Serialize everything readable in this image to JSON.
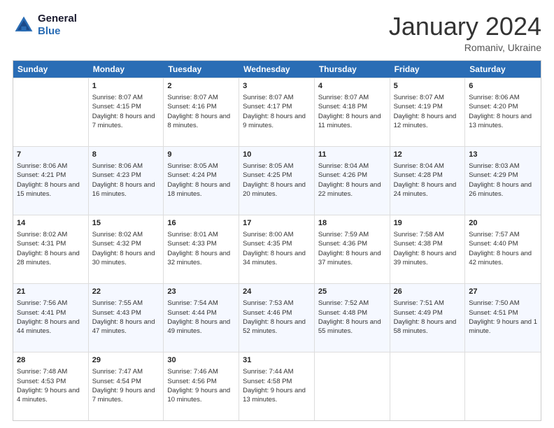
{
  "logo": {
    "line1": "General",
    "line2": "Blue"
  },
  "title": "January 2024",
  "location": "Romaniv, Ukraine",
  "header_days": [
    "Sunday",
    "Monday",
    "Tuesday",
    "Wednesday",
    "Thursday",
    "Friday",
    "Saturday"
  ],
  "weeks": [
    [
      {
        "day": "",
        "sunrise": "",
        "sunset": "",
        "daylight": ""
      },
      {
        "day": "1",
        "sunrise": "Sunrise: 8:07 AM",
        "sunset": "Sunset: 4:15 PM",
        "daylight": "Daylight: 8 hours and 7 minutes."
      },
      {
        "day": "2",
        "sunrise": "Sunrise: 8:07 AM",
        "sunset": "Sunset: 4:16 PM",
        "daylight": "Daylight: 8 hours and 8 minutes."
      },
      {
        "day": "3",
        "sunrise": "Sunrise: 8:07 AM",
        "sunset": "Sunset: 4:17 PM",
        "daylight": "Daylight: 8 hours and 9 minutes."
      },
      {
        "day": "4",
        "sunrise": "Sunrise: 8:07 AM",
        "sunset": "Sunset: 4:18 PM",
        "daylight": "Daylight: 8 hours and 11 minutes."
      },
      {
        "day": "5",
        "sunrise": "Sunrise: 8:07 AM",
        "sunset": "Sunset: 4:19 PM",
        "daylight": "Daylight: 8 hours and 12 minutes."
      },
      {
        "day": "6",
        "sunrise": "Sunrise: 8:06 AM",
        "sunset": "Sunset: 4:20 PM",
        "daylight": "Daylight: 8 hours and 13 minutes."
      }
    ],
    [
      {
        "day": "7",
        "sunrise": "Sunrise: 8:06 AM",
        "sunset": "Sunset: 4:21 PM",
        "daylight": "Daylight: 8 hours and 15 minutes."
      },
      {
        "day": "8",
        "sunrise": "Sunrise: 8:06 AM",
        "sunset": "Sunset: 4:23 PM",
        "daylight": "Daylight: 8 hours and 16 minutes."
      },
      {
        "day": "9",
        "sunrise": "Sunrise: 8:05 AM",
        "sunset": "Sunset: 4:24 PM",
        "daylight": "Daylight: 8 hours and 18 minutes."
      },
      {
        "day": "10",
        "sunrise": "Sunrise: 8:05 AM",
        "sunset": "Sunset: 4:25 PM",
        "daylight": "Daylight: 8 hours and 20 minutes."
      },
      {
        "day": "11",
        "sunrise": "Sunrise: 8:04 AM",
        "sunset": "Sunset: 4:26 PM",
        "daylight": "Daylight: 8 hours and 22 minutes."
      },
      {
        "day": "12",
        "sunrise": "Sunrise: 8:04 AM",
        "sunset": "Sunset: 4:28 PM",
        "daylight": "Daylight: 8 hours and 24 minutes."
      },
      {
        "day": "13",
        "sunrise": "Sunrise: 8:03 AM",
        "sunset": "Sunset: 4:29 PM",
        "daylight": "Daylight: 8 hours and 26 minutes."
      }
    ],
    [
      {
        "day": "14",
        "sunrise": "Sunrise: 8:02 AM",
        "sunset": "Sunset: 4:31 PM",
        "daylight": "Daylight: 8 hours and 28 minutes."
      },
      {
        "day": "15",
        "sunrise": "Sunrise: 8:02 AM",
        "sunset": "Sunset: 4:32 PM",
        "daylight": "Daylight: 8 hours and 30 minutes."
      },
      {
        "day": "16",
        "sunrise": "Sunrise: 8:01 AM",
        "sunset": "Sunset: 4:33 PM",
        "daylight": "Daylight: 8 hours and 32 minutes."
      },
      {
        "day": "17",
        "sunrise": "Sunrise: 8:00 AM",
        "sunset": "Sunset: 4:35 PM",
        "daylight": "Daylight: 8 hours and 34 minutes."
      },
      {
        "day": "18",
        "sunrise": "Sunrise: 7:59 AM",
        "sunset": "Sunset: 4:36 PM",
        "daylight": "Daylight: 8 hours and 37 minutes."
      },
      {
        "day": "19",
        "sunrise": "Sunrise: 7:58 AM",
        "sunset": "Sunset: 4:38 PM",
        "daylight": "Daylight: 8 hours and 39 minutes."
      },
      {
        "day": "20",
        "sunrise": "Sunrise: 7:57 AM",
        "sunset": "Sunset: 4:40 PM",
        "daylight": "Daylight: 8 hours and 42 minutes."
      }
    ],
    [
      {
        "day": "21",
        "sunrise": "Sunrise: 7:56 AM",
        "sunset": "Sunset: 4:41 PM",
        "daylight": "Daylight: 8 hours and 44 minutes."
      },
      {
        "day": "22",
        "sunrise": "Sunrise: 7:55 AM",
        "sunset": "Sunset: 4:43 PM",
        "daylight": "Daylight: 8 hours and 47 minutes."
      },
      {
        "day": "23",
        "sunrise": "Sunrise: 7:54 AM",
        "sunset": "Sunset: 4:44 PM",
        "daylight": "Daylight: 8 hours and 49 minutes."
      },
      {
        "day": "24",
        "sunrise": "Sunrise: 7:53 AM",
        "sunset": "Sunset: 4:46 PM",
        "daylight": "Daylight: 8 hours and 52 minutes."
      },
      {
        "day": "25",
        "sunrise": "Sunrise: 7:52 AM",
        "sunset": "Sunset: 4:48 PM",
        "daylight": "Daylight: 8 hours and 55 minutes."
      },
      {
        "day": "26",
        "sunrise": "Sunrise: 7:51 AM",
        "sunset": "Sunset: 4:49 PM",
        "daylight": "Daylight: 8 hours and 58 minutes."
      },
      {
        "day": "27",
        "sunrise": "Sunrise: 7:50 AM",
        "sunset": "Sunset: 4:51 PM",
        "daylight": "Daylight: 9 hours and 1 minute."
      }
    ],
    [
      {
        "day": "28",
        "sunrise": "Sunrise: 7:48 AM",
        "sunset": "Sunset: 4:53 PM",
        "daylight": "Daylight: 9 hours and 4 minutes."
      },
      {
        "day": "29",
        "sunrise": "Sunrise: 7:47 AM",
        "sunset": "Sunset: 4:54 PM",
        "daylight": "Daylight: 9 hours and 7 minutes."
      },
      {
        "day": "30",
        "sunrise": "Sunrise: 7:46 AM",
        "sunset": "Sunset: 4:56 PM",
        "daylight": "Daylight: 9 hours and 10 minutes."
      },
      {
        "day": "31",
        "sunrise": "Sunrise: 7:44 AM",
        "sunset": "Sunset: 4:58 PM",
        "daylight": "Daylight: 9 hours and 13 minutes."
      },
      {
        "day": "",
        "sunrise": "",
        "sunset": "",
        "daylight": ""
      },
      {
        "day": "",
        "sunrise": "",
        "sunset": "",
        "daylight": ""
      },
      {
        "day": "",
        "sunrise": "",
        "sunset": "",
        "daylight": ""
      }
    ]
  ]
}
